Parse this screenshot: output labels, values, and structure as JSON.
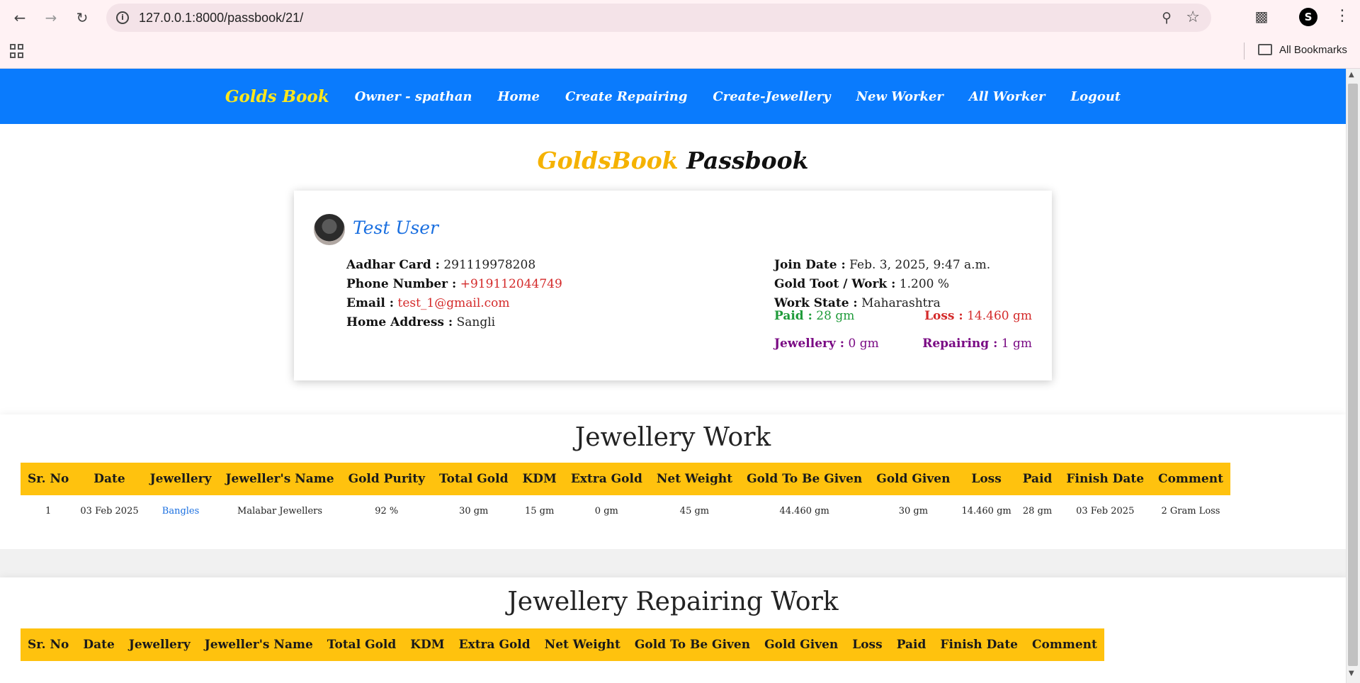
{
  "browser": {
    "url": "127.0.0.1:8000/passbook/21/",
    "bookmarks_label": "All Bookmarks"
  },
  "nav": {
    "brand": "Golds Book",
    "items": [
      "Owner - spathan",
      "Home",
      "Create Repairing",
      "Create-Jewellery",
      "New Worker",
      "All Worker",
      "Logout"
    ]
  },
  "heading": {
    "gold": "GoldsBook",
    "black": "Passbook"
  },
  "profile": {
    "name": "Test User",
    "aadhar_label": "Aadhar Card :",
    "aadhar": "291119978208",
    "phone_label": "Phone Number :",
    "phone": "+919112044749",
    "email_label": "Email :",
    "email": "test_1@gmail.com",
    "address_label": "Home Address :",
    "address": "Sangli",
    "join_label": "Join Date :",
    "join": "Feb. 3, 2025, 9:47 a.m.",
    "toot_label": "Gold Toot / Work :",
    "toot": "1.200 %",
    "state_label": "Work State :",
    "state": "Maharashtra",
    "paid_label": "Paid :",
    "paid": "28 gm",
    "loss_label": "Loss :",
    "loss": "14.460 gm",
    "jewellery_label": "Jewellery :",
    "jewellery": "0 gm",
    "repairing_label": "Repairing :",
    "repairing": "1 gm"
  },
  "jewellery_work": {
    "title": "Jewellery Work",
    "headers": [
      "Sr. No",
      "Date",
      "Jewellery",
      "Jeweller's Name",
      "Gold Purity",
      "Total Gold",
      "KDM",
      "Extra Gold",
      "Net Weight",
      "Gold To Be Given",
      "Gold Given",
      "Loss",
      "Paid",
      "Finish Date",
      "Comment"
    ],
    "rows": [
      [
        "1",
        "03 Feb 2025",
        "Bangles",
        "Malabar Jewellers",
        "92 %",
        "30 gm",
        "15 gm",
        "0 gm",
        "45 gm",
        "44.460 gm",
        "30 gm",
        "14.460 gm",
        "28 gm",
        "03 Feb 2025",
        "2 Gram Loss"
      ]
    ]
  },
  "repairing_work": {
    "title": "Jewellery Repairing Work",
    "headers": [
      "Sr. No",
      "Date",
      "Jewellery",
      "Jeweller's Name",
      "Total Gold",
      "KDM",
      "Extra Gold",
      "Net Weight",
      "Gold To Be Given",
      "Gold Given",
      "Loss",
      "Paid",
      "Finish Date",
      "Comment"
    ]
  }
}
